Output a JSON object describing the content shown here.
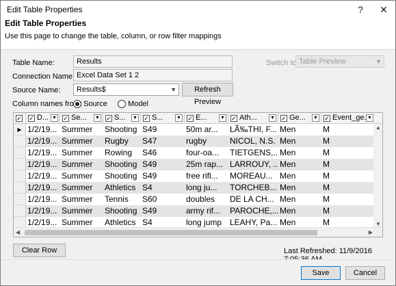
{
  "window": {
    "title": "Edit Table Properties",
    "help_glyph": "?",
    "close_glyph": "✕"
  },
  "header": {
    "title": "Edit Table Properties",
    "description": "Use this page to change the table, column, or row filter mappings"
  },
  "form": {
    "table_name_label": "Table Name:",
    "table_name_value": "Results",
    "connection_name_label": "Connection Name:",
    "connection_name_value": "Excel Data Set 1 2",
    "source_name_label": "Source Name:",
    "source_name_value": "Results$",
    "refresh_preview_label": "Refresh Preview",
    "switch_to_label": "Switch to:",
    "switch_to_value": "Table Preview",
    "column_names_from_label": "Column names from:",
    "radio_source_label": "Source",
    "radio_model_label": "Model",
    "column_names_selected": "Source"
  },
  "grid": {
    "columns": [
      "D...",
      "Se...",
      "S...",
      "S...",
      "E...",
      "Ath...",
      "Ge...",
      "Event_ge..."
    ],
    "rows": [
      [
        "1/2/19...",
        "Summer",
        "Shooting",
        "S49",
        "50m ar...",
        "LÃ‰THI, F...",
        "Men",
        "M"
      ],
      [
        "1/2/19...",
        "Summer",
        "Rugby",
        "S47",
        "rugby",
        "NICOL, N.S.",
        "Men",
        "M"
      ],
      [
        "1/2/19...",
        "Summer",
        "Rowing",
        "S46",
        "four-oa...",
        "TIETGENS,...",
        "Men",
        "M"
      ],
      [
        "1/2/19...",
        "Summer",
        "Shooting",
        "S49",
        "25m rap...",
        "LARROUY, ...",
        "Men",
        "M"
      ],
      [
        "1/2/19...",
        "Summer",
        "Shooting",
        "S49",
        "free rifl...",
        "MOREAU...",
        "Men",
        "M"
      ],
      [
        "1/2/19...",
        "Summer",
        "Athletics",
        "S4",
        "long ju...",
        "TORCHEB...",
        "Men",
        "M"
      ],
      [
        "1/2/19...",
        "Summer",
        "Tennis",
        "S60",
        "doubles",
        "DE LA CH...",
        "Men",
        "M"
      ],
      [
        "1/2/19...",
        "Summer",
        "Shooting",
        "S49",
        "army rif...",
        "PAROCHE,...",
        "Men",
        "M"
      ],
      [
        "1/2/19...",
        "Summer",
        "Athletics",
        "S4",
        "long jump",
        "LEAHY, Pa...",
        "Men",
        "M"
      ]
    ]
  },
  "footer": {
    "clear_row_filters_label": "Clear Row Filters",
    "last_refreshed": "Last Refreshed: 11/9/2016 7:05:36 AM",
    "save_label": "Save",
    "cancel_label": "Cancel"
  },
  "colors": {
    "primary_border": "#0078d7",
    "alt_row": "#e4e4e4"
  }
}
